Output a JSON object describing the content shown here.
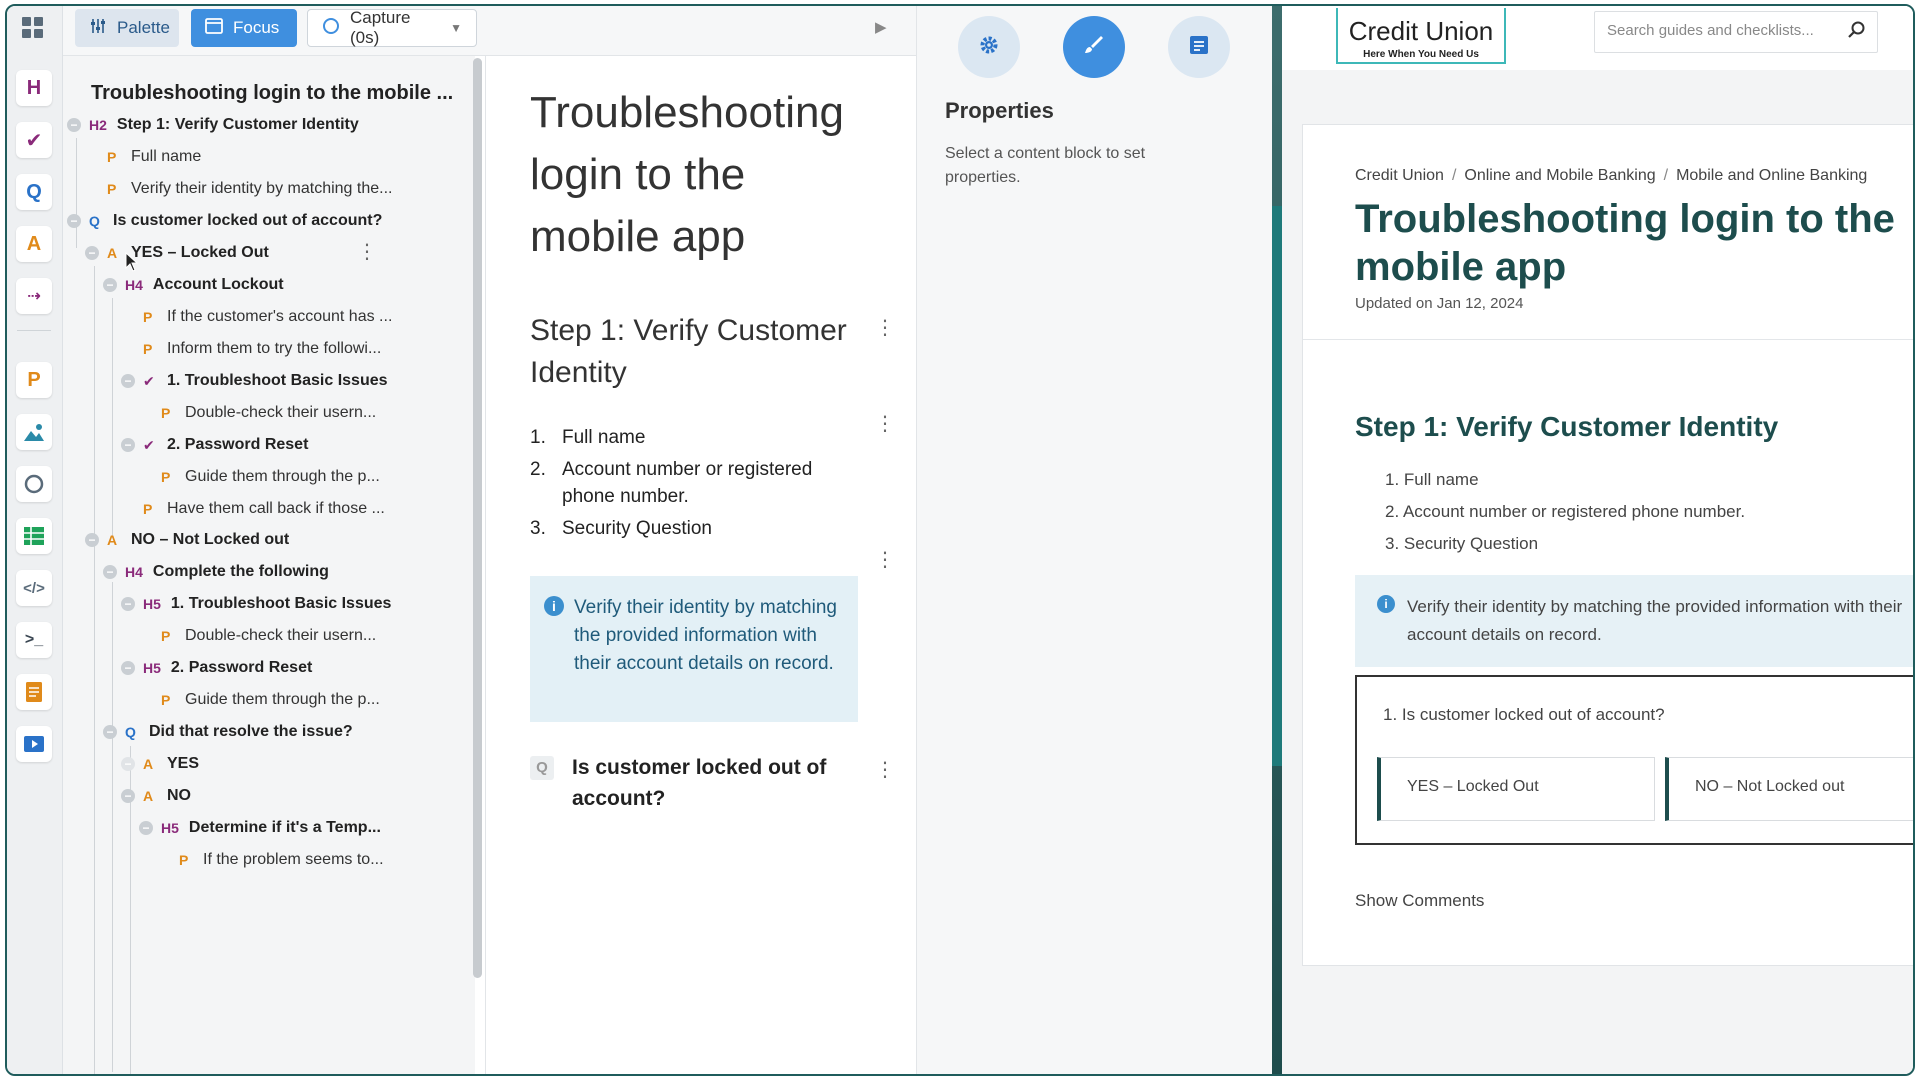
{
  "toolbar": {
    "palette_label": "Palette",
    "focus_label": "Focus",
    "capture_label": "Capture (0s)"
  },
  "outline": {
    "title": "Troubleshooting login to the mobile ...",
    "items": [
      {
        "badge": "H2",
        "label": "Step 1: Verify Customer Identity"
      },
      {
        "badge": "P",
        "label": "Full name"
      },
      {
        "badge": "P",
        "label": "Verify their identity by matching the..."
      },
      {
        "badge": "Q",
        "label": "Is customer locked out of account?"
      },
      {
        "badge": "A",
        "label": "YES – Locked Out"
      },
      {
        "badge": "H4",
        "label": "Account Lockout"
      },
      {
        "badge": "P",
        "label": "If the customer's account has ..."
      },
      {
        "badge": "P",
        "label": "Inform them to try the followi..."
      },
      {
        "badge": "✔",
        "label": "1. Troubleshoot Basic Issues"
      },
      {
        "badge": "P",
        "label": "Double-check their usern..."
      },
      {
        "badge": "✔",
        "label": "2. Password Reset"
      },
      {
        "badge": "P",
        "label": "Guide them through the p..."
      },
      {
        "badge": "P",
        "label": "Have them call back if those ..."
      },
      {
        "badge": "A",
        "label": "NO – Not Locked out"
      },
      {
        "badge": "H4",
        "label": "Complete the following"
      },
      {
        "badge": "H5",
        "label": "1. Troubleshoot Basic Issues"
      },
      {
        "badge": "P",
        "label": "Double-check their usern..."
      },
      {
        "badge": "H5",
        "label": "2. Password Reset"
      },
      {
        "badge": "P",
        "label": "Guide them through the p..."
      },
      {
        "badge": "Q",
        "label": "Did that resolve the issue?"
      },
      {
        "badge": "A",
        "label": "YES"
      },
      {
        "badge": "A",
        "label": "NO"
      },
      {
        "badge": "H5",
        "label": "Determine if it's a Temp..."
      },
      {
        "badge": "P",
        "label": "If the problem seems to..."
      }
    ]
  },
  "editor": {
    "title": "Troubleshooting login to the mobile app",
    "step_heading": "Step 1: Verify Customer Identity",
    "list": [
      {
        "n": "1.",
        "text": "Full name"
      },
      {
        "n": "2.",
        "text": "Account number or registered phone number."
      },
      {
        "n": "3.",
        "text": "Security Question"
      }
    ],
    "info_text": "Verify their identity by matching the provided information with their account details on record.",
    "question_badge": "Q",
    "question_text": "Is customer locked out of account?"
  },
  "properties": {
    "title": "Properties",
    "hint": "Select a content block to set properties."
  },
  "preview": {
    "brand_name": "Credit Union",
    "brand_tagline": "Here When You Need Us",
    "search_placeholder": "Search guides and checklists...",
    "breadcrumbs": [
      "Credit Union",
      "Online and Mobile Banking",
      "Mobile and Online Banking"
    ],
    "title": "Troubleshooting login to the mobile app",
    "updated": "Updated on Jan 12, 2024",
    "step_heading": "Step 1: Verify Customer Identity",
    "list": [
      "1. Full name",
      "2. Account number or registered phone number.",
      "3. Security Question"
    ],
    "info_text": "Verify their identity by matching the provided information with their account details on record.",
    "question_text": "1. Is customer locked out of account?",
    "answer_yes": "YES – Locked Out",
    "answer_no": "NO – Not Locked out",
    "show_comments": "Show Comments"
  },
  "rail_icons": {
    "top": "grid-icon",
    "items": [
      "heading-icon",
      "checklist-icon",
      "question-icon",
      "answer-icon",
      "link-icon",
      "paragraph-icon",
      "image-icon",
      "shape-icon",
      "table-icon",
      "code-icon",
      "terminal-icon",
      "note-icon",
      "video-icon"
    ]
  },
  "colors": {
    "accent": "#3f8fdf",
    "brand": "#1d4d4d",
    "info_bg": "#e3f0f6",
    "badge_h": "#8a2a7a",
    "badge_q": "#2a72c8",
    "badge_p": "#e08a1a"
  }
}
